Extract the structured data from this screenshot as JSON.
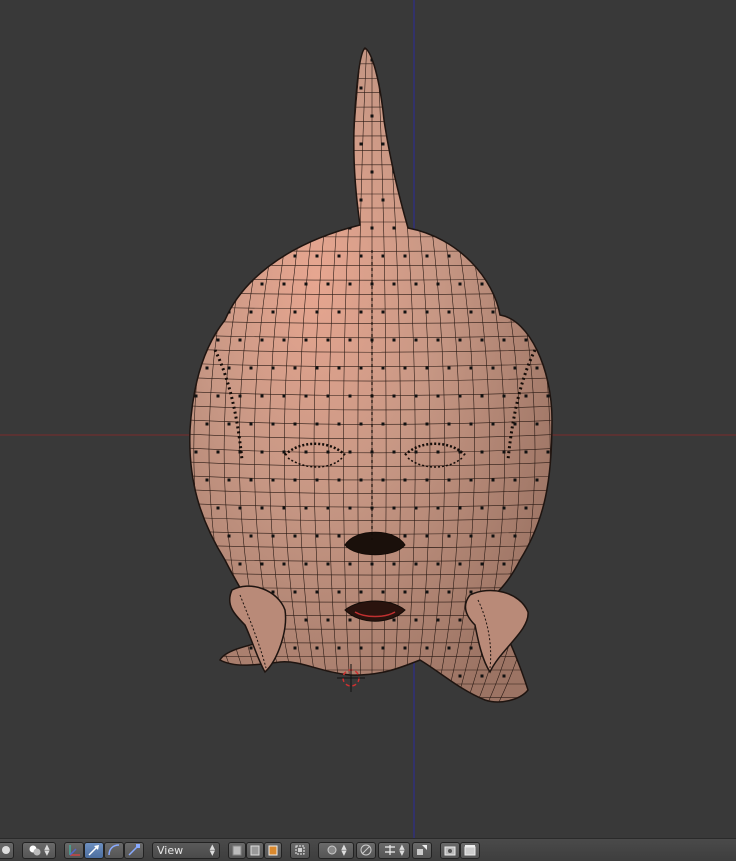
{
  "viewport": {
    "background": "#393939",
    "x_axis_color": "#8c2a2a",
    "y_axis_color": "#2c2c9a",
    "mesh_color": "#c99a86",
    "mesh_highlight": "#e0a48f",
    "wire_color": "#1e1410",
    "cursor_color": "#d03030"
  },
  "header": {
    "view_menu_label": "View",
    "icons": [
      "editor-type-icon",
      "shading-mode-icon",
      "manipulator-icon",
      "translate-icon",
      "rotate-icon",
      "scale-icon",
      "view-menu",
      "solid-shading-icon",
      "wireframe-shading-icon",
      "texture-shading-icon",
      "layer-button-icon",
      "pivot-point-icon",
      "proportional-edit-icon",
      "snap-icon",
      "snap-element-icon",
      "render-icon",
      "render-animation-icon"
    ]
  }
}
